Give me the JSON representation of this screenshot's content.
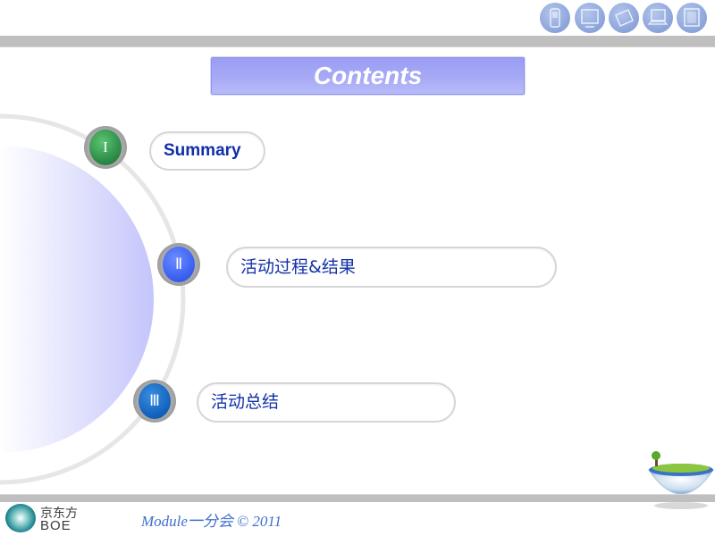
{
  "header": {
    "device_icons": [
      {
        "name": "mobile-phone-icon"
      },
      {
        "name": "monitor-icon"
      },
      {
        "name": "tablet-icon"
      },
      {
        "name": "laptop-icon"
      },
      {
        "name": "display-panel-icon"
      }
    ]
  },
  "title": "Contents",
  "sections": [
    {
      "numeral": "I",
      "label": "Summary",
      "badge_color": "#2f8f4a"
    },
    {
      "numeral": "Ⅱ",
      "label": "活动过程&结果",
      "badge_color": "#3d63f2"
    },
    {
      "numeral": "Ⅲ",
      "label": "活动总结",
      "badge_color": "#1566c0"
    }
  ],
  "footer": {
    "logo_cn": "京东方",
    "logo_en": "BOE",
    "text": "Module一分会 © 2011"
  }
}
